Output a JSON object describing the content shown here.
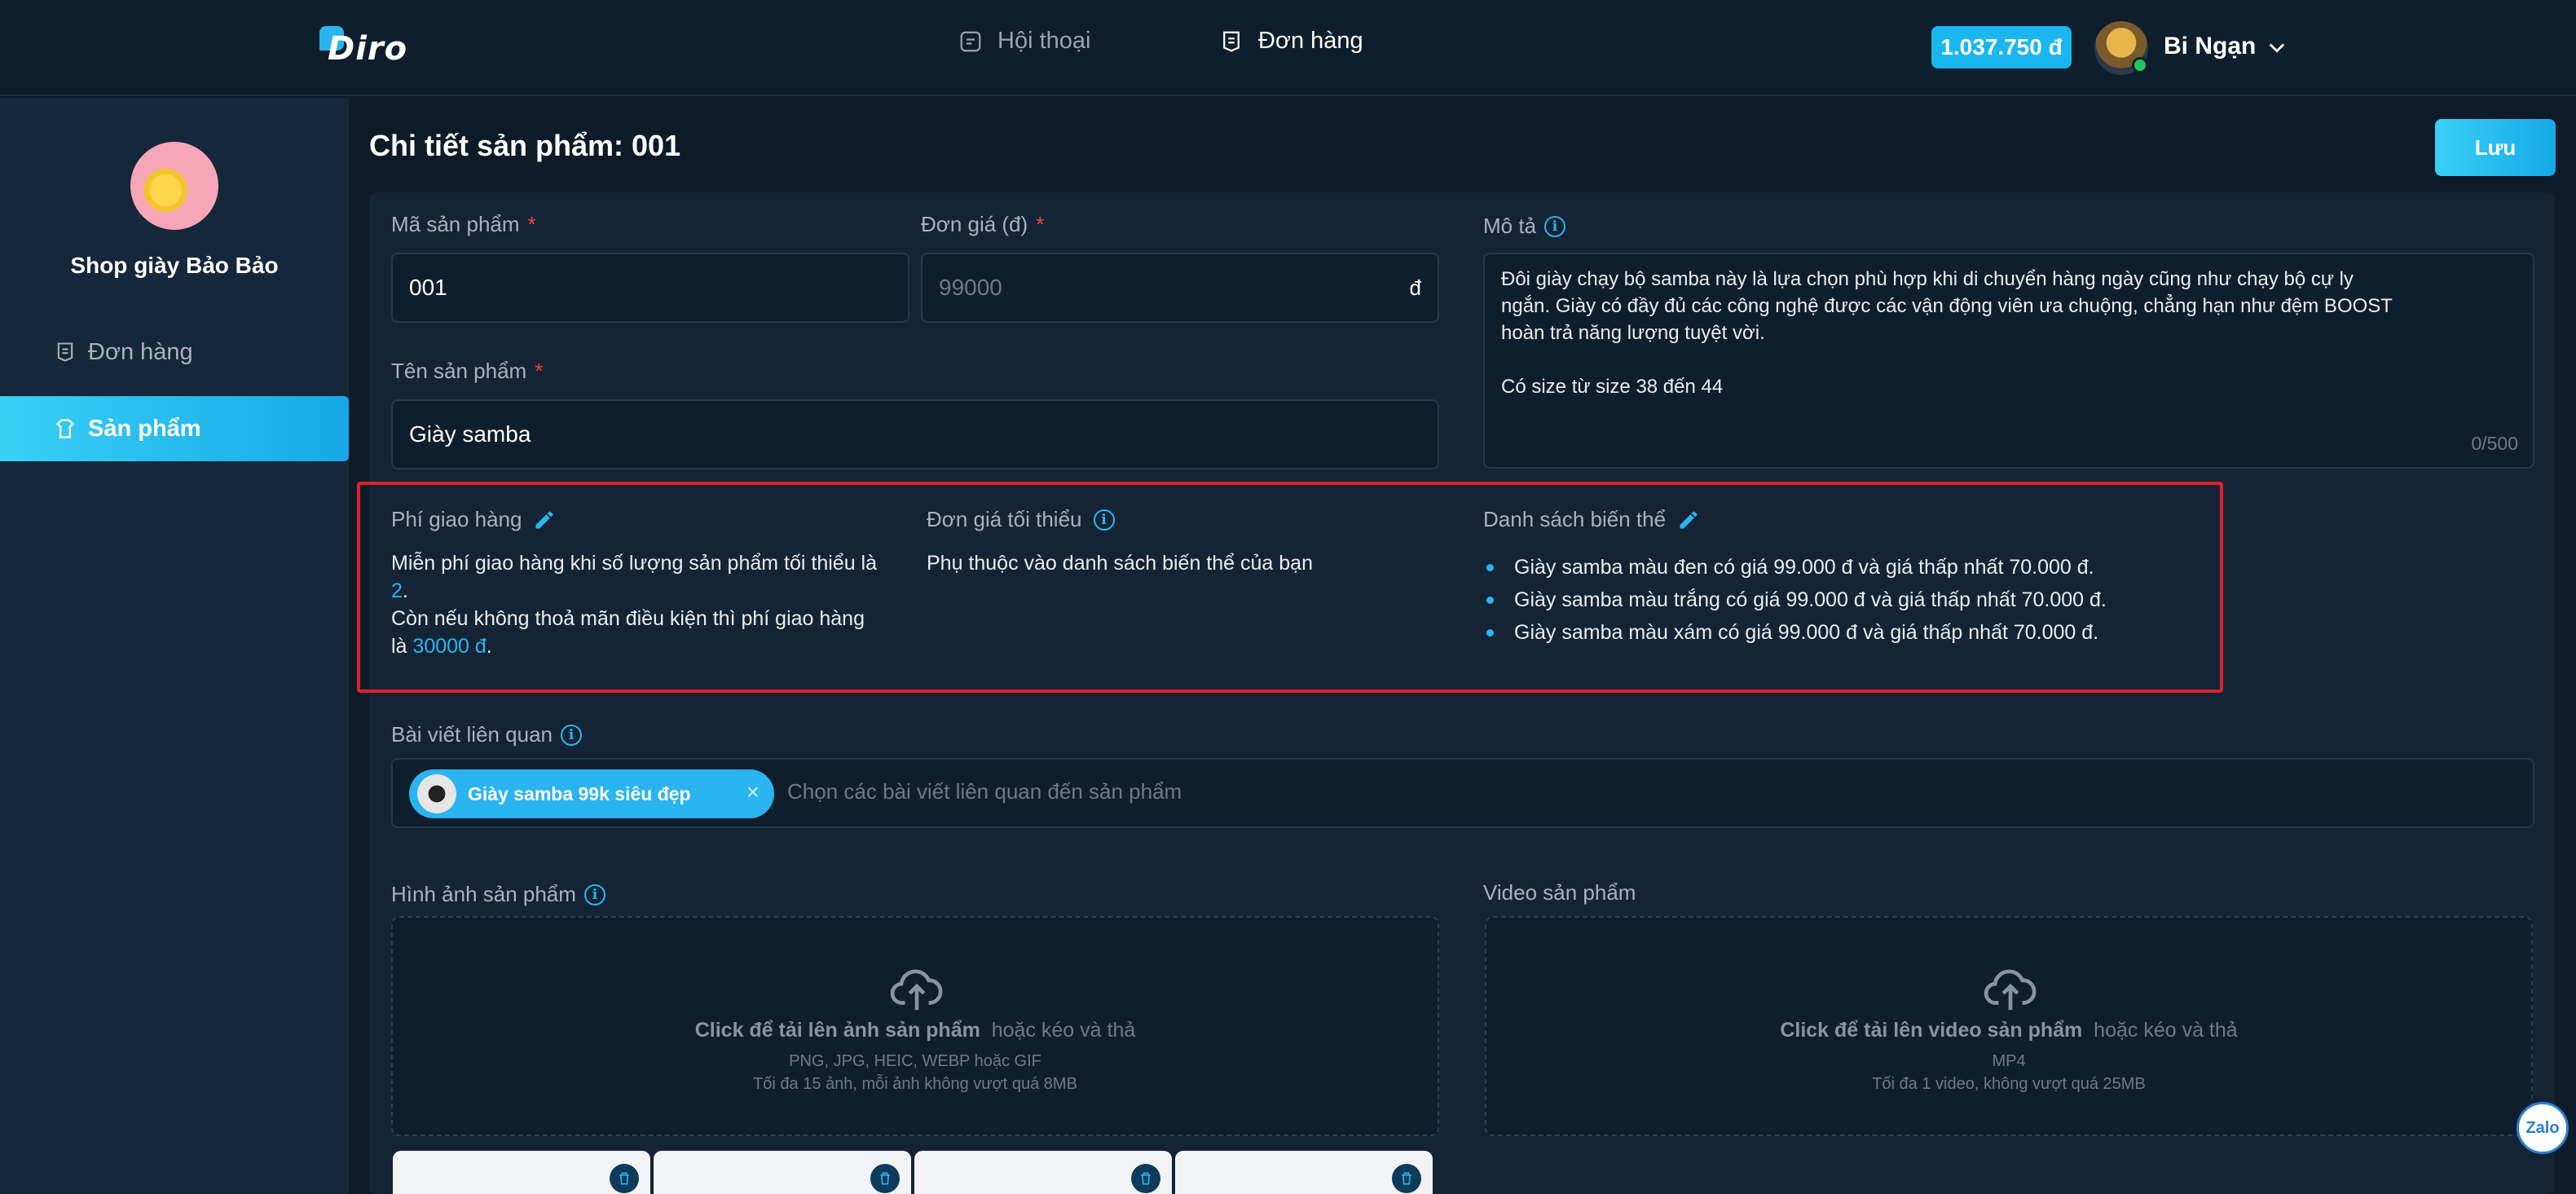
{
  "header": {
    "logo_text": "Diro",
    "nav": [
      {
        "label": "Hội thoại"
      },
      {
        "label": "Đơn hàng"
      }
    ],
    "balance": "1.037.750 đ",
    "user_name": "Bi Ngạn"
  },
  "sidebar": {
    "shop_name": "Shop giày Bảo Bảo",
    "items": [
      {
        "label": "Đơn hàng"
      },
      {
        "label": "Sản phẩm"
      }
    ]
  },
  "page": {
    "title": "Chi tiết sản phẩm: 001",
    "save_label": "Lưu"
  },
  "form": {
    "code": {
      "label": "Mã sản phẩm",
      "required_mark": "*",
      "value": "001"
    },
    "price": {
      "label": "Đơn giá (đ)",
      "required_mark": "*",
      "value": "99000",
      "unit": "đ"
    },
    "name": {
      "label": "Tên sản phẩm",
      "required_mark": "*",
      "value": "Giày samba"
    },
    "description": {
      "label": "Mô tả",
      "info_icon": "i",
      "lines": [
        "Đôi giày chạy bộ samba này là lựa chọn phù hợp khi di chuyển hàng ngày cũng như chạy bộ cự ly",
        "ngắn. Giày có đầy đủ các công nghệ được các vận động viên ưa chuộng, chẳng hạn như đệm BOOST",
        "hoàn trả năng lượng tuyệt vời.",
        "",
        "Có size từ size 38 đến 44"
      ],
      "counter": "0/500"
    }
  },
  "shipping": {
    "title": "Phí giao hàng",
    "line1": "Miễn phí giao hàng khi số lượng sản phẩm tối thiểu là",
    "min_qty": "2",
    "line2": "Còn nếu không thoả mãn điều kiện thì phí giao hàng",
    "line3_prefix": "là",
    "fee": "30000 đ"
  },
  "min_price": {
    "title": "Đơn giá tối thiểu",
    "info_icon": "i",
    "text": "Phụ thuộc vào danh sách biến thể của bạn"
  },
  "variants": {
    "title": "Danh sách biến thể",
    "items": [
      "Giày samba màu đen có giá 99.000 đ và giá thấp nhất 70.000 đ.",
      "Giày samba màu trắng có giá 99.000 đ và giá thấp nhất 70.000 đ.",
      "Giày samba màu xám có giá 99.000 đ và giá thấp nhất 70.000 đ."
    ]
  },
  "related": {
    "label": "Bài viết liên quan",
    "info_icon": "i",
    "chip_label": "Giày samba 99k siêu đẹp",
    "chip_close": "×",
    "placeholder": "Chọn các bài viết liên quan đến sản phẩm"
  },
  "images": {
    "label": "Hình ảnh sản phẩm",
    "info_icon": "i",
    "cta_bold": "Click để tải lên ảnh sản phẩm",
    "cta_rest": "hoặc kéo và thả",
    "formats": "PNG, JPG, HEIC, WEBP hoặc GIF",
    "limits": "Tối đa 15 ảnh, mỗi ảnh không vượt quá 8MB"
  },
  "video": {
    "label": "Video sản phẩm",
    "cta_bold": "Click để tải lên video sản phẩm",
    "cta_rest": "hoặc kéo và thả",
    "formats": "MP4",
    "limits": "Tối đa 1 video, không vượt quá 25MB"
  },
  "zalo_label": "Zalo",
  "colors": {
    "accent": "#2ab4f0",
    "highlight_border": "#e0202a",
    "required": "#ef4444",
    "background": "#0d1b29"
  }
}
